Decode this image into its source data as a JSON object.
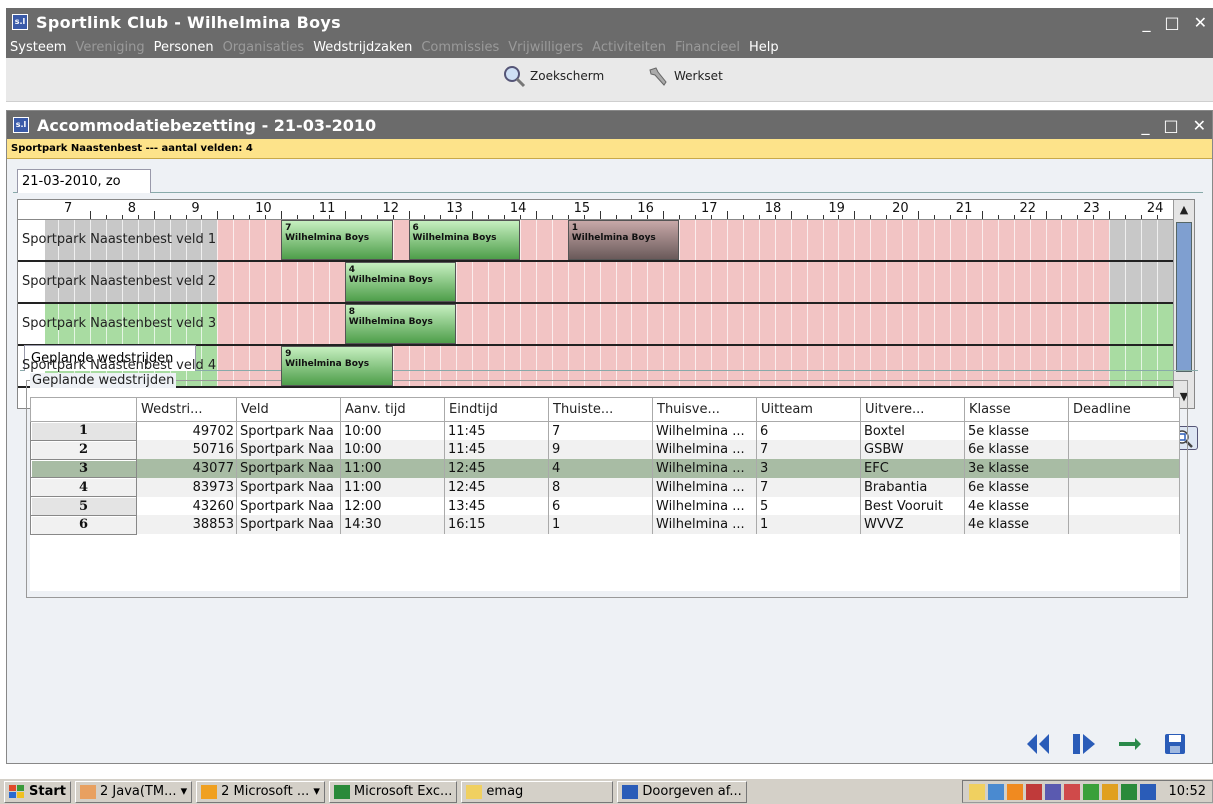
{
  "window": {
    "title": "Sportlink Club - Wilhelmina Boys",
    "logo": "s.l",
    "controls": [
      "_",
      "□",
      "✕"
    ]
  },
  "menu": [
    {
      "label": "Systeem",
      "enabled": true
    },
    {
      "label": "Vereniging",
      "enabled": false
    },
    {
      "label": "Personen",
      "enabled": true
    },
    {
      "label": "Organisaties",
      "enabled": false
    },
    {
      "label": "Wedstrijdzaken",
      "enabled": true
    },
    {
      "label": "Commissies",
      "enabled": false
    },
    {
      "label": "Vrijwilligers",
      "enabled": false
    },
    {
      "label": "Activiteiten",
      "enabled": false
    },
    {
      "label": "Financieel",
      "enabled": false
    },
    {
      "label": "Help",
      "enabled": true
    }
  ],
  "toolbar": {
    "search_label": "Zoekscherm",
    "workset_label": "Werkset"
  },
  "subwindow": {
    "title": "Accommodatiebezetting - 21-03-2010",
    "info": "Sportpark Naastenbest ---  aantal velden: 4",
    "day_tab": "21-03-2010, zo"
  },
  "timeline": {
    "hours": [
      "7",
      "8",
      "9",
      "10",
      "11",
      "12",
      "13",
      "14",
      "15",
      "16",
      "17",
      "18",
      "19",
      "20",
      "21",
      "22",
      "23",
      "24"
    ],
    "lanes": [
      {
        "label": "Sportpark Naastenbest veld 1"
      },
      {
        "label": "Sportpark Naastenbest veld 2"
      },
      {
        "label": "Sportpark Naastenbest veld 3"
      },
      {
        "label": "Sportpark Naastenbest veld 4"
      }
    ],
    "matches": [
      {
        "lane": 0,
        "num": "7",
        "team": "Wilhelmina Boys",
        "start": 10.0,
        "end": 11.75,
        "color": "green"
      },
      {
        "lane": 0,
        "num": "6",
        "team": "Wilhelmina Boys",
        "start": 12.0,
        "end": 13.75,
        "color": "green"
      },
      {
        "lane": 0,
        "num": "1",
        "team": "Wilhelmina Boys",
        "start": 14.5,
        "end": 16.25,
        "color": "dark"
      },
      {
        "lane": 1,
        "num": "4",
        "team": "Wilhelmina Boys",
        "start": 11.0,
        "end": 12.75,
        "color": "green"
      },
      {
        "lane": 2,
        "num": "8",
        "team": "Wilhelmina Boys",
        "start": 11.0,
        "end": 12.75,
        "color": "green"
      },
      {
        "lane": 3,
        "num": "9",
        "team": "Wilhelmina Boys",
        "start": 10.0,
        "end": 11.75,
        "color": "green"
      }
    ],
    "grip": "••••••"
  },
  "planned": {
    "tab_label": "Geplande wedstrijden",
    "box_label": "Geplande wedstrijden",
    "columns": [
      "Wedstri...",
      "Veld",
      "Aanv. tijd",
      "Eindtijd",
      "Thuiste...",
      "Thuisve...",
      "Uitteam",
      "Uitvere...",
      "Klasse",
      "Deadline"
    ],
    "rows": [
      {
        "n": "1",
        "cells": [
          "49702",
          "Sportpark Naa",
          "10:00",
          "11:45",
          "7",
          "Wilhelmina ...",
          "6",
          "Boxtel",
          "5e klasse",
          ""
        ]
      },
      {
        "n": "2",
        "cells": [
          "50716",
          "Sportpark Naa",
          "10:00",
          "11:45",
          "9",
          "Wilhelmina ...",
          "7",
          "GSBW",
          "6e klasse",
          ""
        ]
      },
      {
        "n": "3",
        "cells": [
          "43077",
          "Sportpark Naa",
          "11:00",
          "12:45",
          "4",
          "Wilhelmina ...",
          "3",
          "EFC",
          "3e klasse",
          ""
        ]
      },
      {
        "n": "4",
        "cells": [
          "83973",
          "Sportpark Naa",
          "11:00",
          "12:45",
          "8",
          "Wilhelmina ...",
          "7",
          "Brabantia",
          "6e klasse",
          ""
        ]
      },
      {
        "n": "5",
        "cells": [
          "43260",
          "Sportpark Naa",
          "12:00",
          "13:45",
          "6",
          "Wilhelmina ...",
          "5",
          "Best Vooruit",
          "4e klasse",
          ""
        ]
      },
      {
        "n": "6",
        "cells": [
          "38853",
          "Sportpark Naa",
          "14:30",
          "16:15",
          "1",
          "Wilhelmina ...",
          "1",
          "WVVZ",
          "4e klasse",
          ""
        ]
      }
    ],
    "selected_row": 2
  },
  "taskbar": {
    "start": "Start",
    "items": [
      "2 Java(TM... ▾",
      "2 Microsoft ... ▾",
      "Microsoft Exc...",
      "emag",
      "Doorgeven af..."
    ],
    "clock": "10:52"
  },
  "colors": {
    "accent": "#6b6b6b",
    "info": "#fde38a",
    "pink": "#f2c4c4",
    "green": "#a9dca2",
    "gray": "#c8c8c8",
    "selected": "#a8bca4"
  }
}
